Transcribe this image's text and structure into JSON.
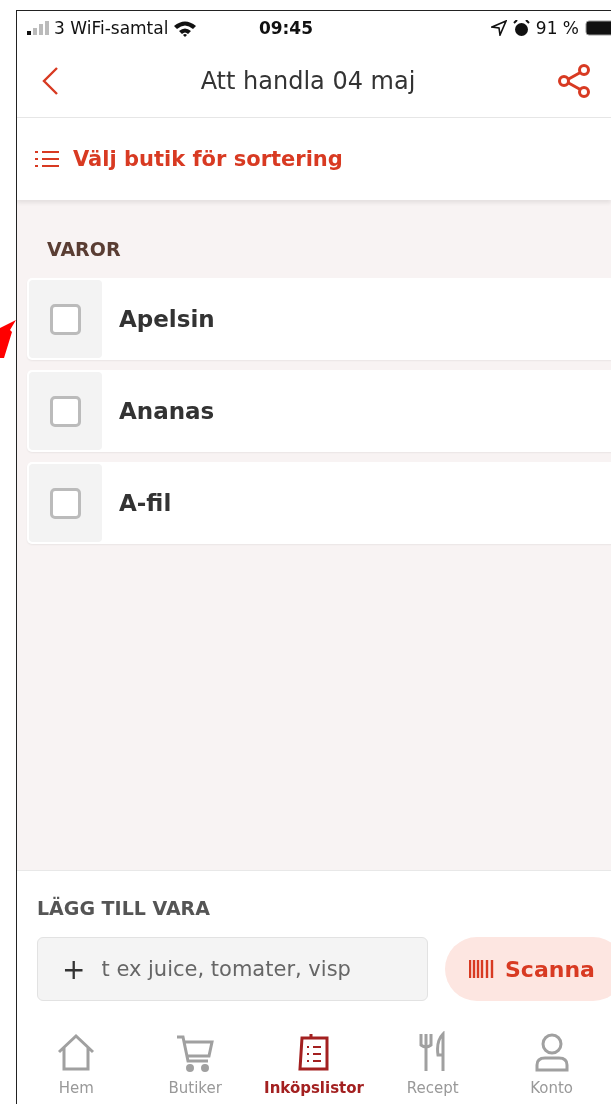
{
  "status_bar": {
    "carrier": "3 WiFi-samtal",
    "time": "09:45",
    "battery": "91 %"
  },
  "nav": {
    "title": "Att handla 04 maj"
  },
  "sort_button": {
    "label": "Välj butik för sortering"
  },
  "section": {
    "title": "VAROR"
  },
  "items": [
    {
      "name": "Apelsin",
      "checked": false
    },
    {
      "name": "Ananas",
      "checked": false
    },
    {
      "name": "A-fil",
      "checked": false
    }
  ],
  "add_panel": {
    "title": "LÄGG TILL VARA",
    "icon": "+",
    "placeholder": "t ex juice, tomater, visp",
    "scan_label": "Scanna"
  },
  "tabs": [
    {
      "label": "Hem",
      "kind": "home",
      "selected": false
    },
    {
      "label": "Butiker",
      "kind": "cart",
      "selected": false
    },
    {
      "label": "Inköpslistor",
      "kind": "list",
      "selected": true
    },
    {
      "label": "Recept",
      "kind": "recipe",
      "selected": false
    },
    {
      "label": "Konto",
      "kind": "account",
      "selected": false
    }
  ]
}
